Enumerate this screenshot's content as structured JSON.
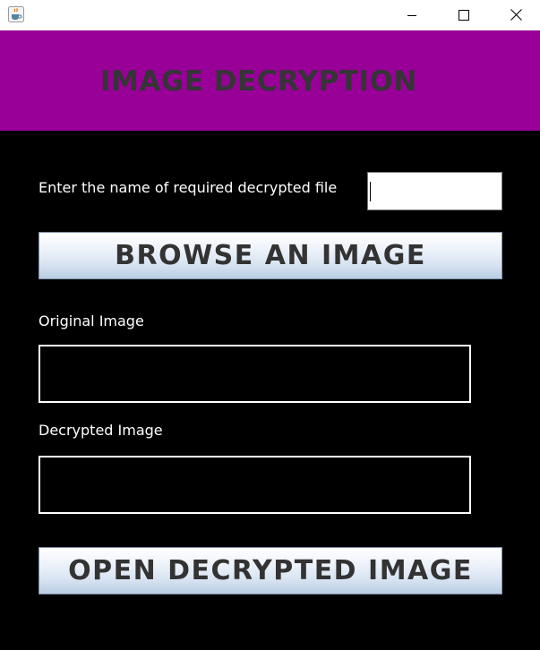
{
  "window": {
    "title_icon": "java-coffee-cup-icon",
    "controls": {
      "minimize_icon": "minimize-icon",
      "maximize_icon": "maximize-icon",
      "close_icon": "close-icon"
    }
  },
  "header": {
    "title": "IMAGE DECRYPTION",
    "background": "#980098",
    "text_color": "#353535"
  },
  "form": {
    "filename_prompt": "Enter the name of required decrypted file",
    "filename_value": ""
  },
  "buttons": {
    "browse_label": "BROWSE AN IMAGE",
    "open_label": "OPEN DECRYPTED IMAGE"
  },
  "images": {
    "original_label": "Original Image",
    "decrypted_label": "Decrypted Image"
  },
  "colors": {
    "background": "#000000",
    "label_text": "#ffffff"
  }
}
